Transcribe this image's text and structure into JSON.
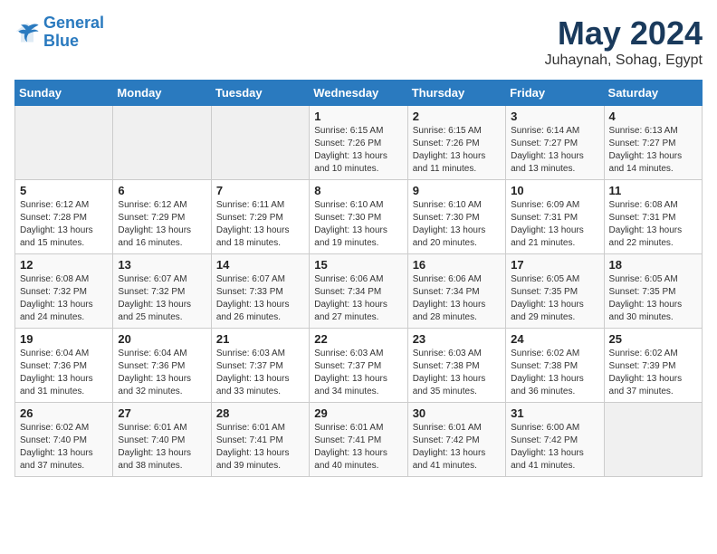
{
  "header": {
    "logo_line1": "General",
    "logo_line2": "Blue",
    "month_title": "May 2024",
    "location": "Juhaynah, Sohag, Egypt"
  },
  "weekdays": [
    "Sunday",
    "Monday",
    "Tuesday",
    "Wednesday",
    "Thursday",
    "Friday",
    "Saturday"
  ],
  "weeks": [
    [
      {
        "day": "",
        "info": ""
      },
      {
        "day": "",
        "info": ""
      },
      {
        "day": "",
        "info": ""
      },
      {
        "day": "1",
        "info": "Sunrise: 6:15 AM\nSunset: 7:26 PM\nDaylight: 13 hours\nand 10 minutes."
      },
      {
        "day": "2",
        "info": "Sunrise: 6:15 AM\nSunset: 7:26 PM\nDaylight: 13 hours\nand 11 minutes."
      },
      {
        "day": "3",
        "info": "Sunrise: 6:14 AM\nSunset: 7:27 PM\nDaylight: 13 hours\nand 13 minutes."
      },
      {
        "day": "4",
        "info": "Sunrise: 6:13 AM\nSunset: 7:27 PM\nDaylight: 13 hours\nand 14 minutes."
      }
    ],
    [
      {
        "day": "5",
        "info": "Sunrise: 6:12 AM\nSunset: 7:28 PM\nDaylight: 13 hours\nand 15 minutes."
      },
      {
        "day": "6",
        "info": "Sunrise: 6:12 AM\nSunset: 7:29 PM\nDaylight: 13 hours\nand 16 minutes."
      },
      {
        "day": "7",
        "info": "Sunrise: 6:11 AM\nSunset: 7:29 PM\nDaylight: 13 hours\nand 18 minutes."
      },
      {
        "day": "8",
        "info": "Sunrise: 6:10 AM\nSunset: 7:30 PM\nDaylight: 13 hours\nand 19 minutes."
      },
      {
        "day": "9",
        "info": "Sunrise: 6:10 AM\nSunset: 7:30 PM\nDaylight: 13 hours\nand 20 minutes."
      },
      {
        "day": "10",
        "info": "Sunrise: 6:09 AM\nSunset: 7:31 PM\nDaylight: 13 hours\nand 21 minutes."
      },
      {
        "day": "11",
        "info": "Sunrise: 6:08 AM\nSunset: 7:31 PM\nDaylight: 13 hours\nand 22 minutes."
      }
    ],
    [
      {
        "day": "12",
        "info": "Sunrise: 6:08 AM\nSunset: 7:32 PM\nDaylight: 13 hours\nand 24 minutes."
      },
      {
        "day": "13",
        "info": "Sunrise: 6:07 AM\nSunset: 7:32 PM\nDaylight: 13 hours\nand 25 minutes."
      },
      {
        "day": "14",
        "info": "Sunrise: 6:07 AM\nSunset: 7:33 PM\nDaylight: 13 hours\nand 26 minutes."
      },
      {
        "day": "15",
        "info": "Sunrise: 6:06 AM\nSunset: 7:34 PM\nDaylight: 13 hours\nand 27 minutes."
      },
      {
        "day": "16",
        "info": "Sunrise: 6:06 AM\nSunset: 7:34 PM\nDaylight: 13 hours\nand 28 minutes."
      },
      {
        "day": "17",
        "info": "Sunrise: 6:05 AM\nSunset: 7:35 PM\nDaylight: 13 hours\nand 29 minutes."
      },
      {
        "day": "18",
        "info": "Sunrise: 6:05 AM\nSunset: 7:35 PM\nDaylight: 13 hours\nand 30 minutes."
      }
    ],
    [
      {
        "day": "19",
        "info": "Sunrise: 6:04 AM\nSunset: 7:36 PM\nDaylight: 13 hours\nand 31 minutes."
      },
      {
        "day": "20",
        "info": "Sunrise: 6:04 AM\nSunset: 7:36 PM\nDaylight: 13 hours\nand 32 minutes."
      },
      {
        "day": "21",
        "info": "Sunrise: 6:03 AM\nSunset: 7:37 PM\nDaylight: 13 hours\nand 33 minutes."
      },
      {
        "day": "22",
        "info": "Sunrise: 6:03 AM\nSunset: 7:37 PM\nDaylight: 13 hours\nand 34 minutes."
      },
      {
        "day": "23",
        "info": "Sunrise: 6:03 AM\nSunset: 7:38 PM\nDaylight: 13 hours\nand 35 minutes."
      },
      {
        "day": "24",
        "info": "Sunrise: 6:02 AM\nSunset: 7:38 PM\nDaylight: 13 hours\nand 36 minutes."
      },
      {
        "day": "25",
        "info": "Sunrise: 6:02 AM\nSunset: 7:39 PM\nDaylight: 13 hours\nand 37 minutes."
      }
    ],
    [
      {
        "day": "26",
        "info": "Sunrise: 6:02 AM\nSunset: 7:40 PM\nDaylight: 13 hours\nand 37 minutes."
      },
      {
        "day": "27",
        "info": "Sunrise: 6:01 AM\nSunset: 7:40 PM\nDaylight: 13 hours\nand 38 minutes."
      },
      {
        "day": "28",
        "info": "Sunrise: 6:01 AM\nSunset: 7:41 PM\nDaylight: 13 hours\nand 39 minutes."
      },
      {
        "day": "29",
        "info": "Sunrise: 6:01 AM\nSunset: 7:41 PM\nDaylight: 13 hours\nand 40 minutes."
      },
      {
        "day": "30",
        "info": "Sunrise: 6:01 AM\nSunset: 7:42 PM\nDaylight: 13 hours\nand 41 minutes."
      },
      {
        "day": "31",
        "info": "Sunrise: 6:00 AM\nSunset: 7:42 PM\nDaylight: 13 hours\nand 41 minutes."
      },
      {
        "day": "",
        "info": ""
      }
    ]
  ]
}
